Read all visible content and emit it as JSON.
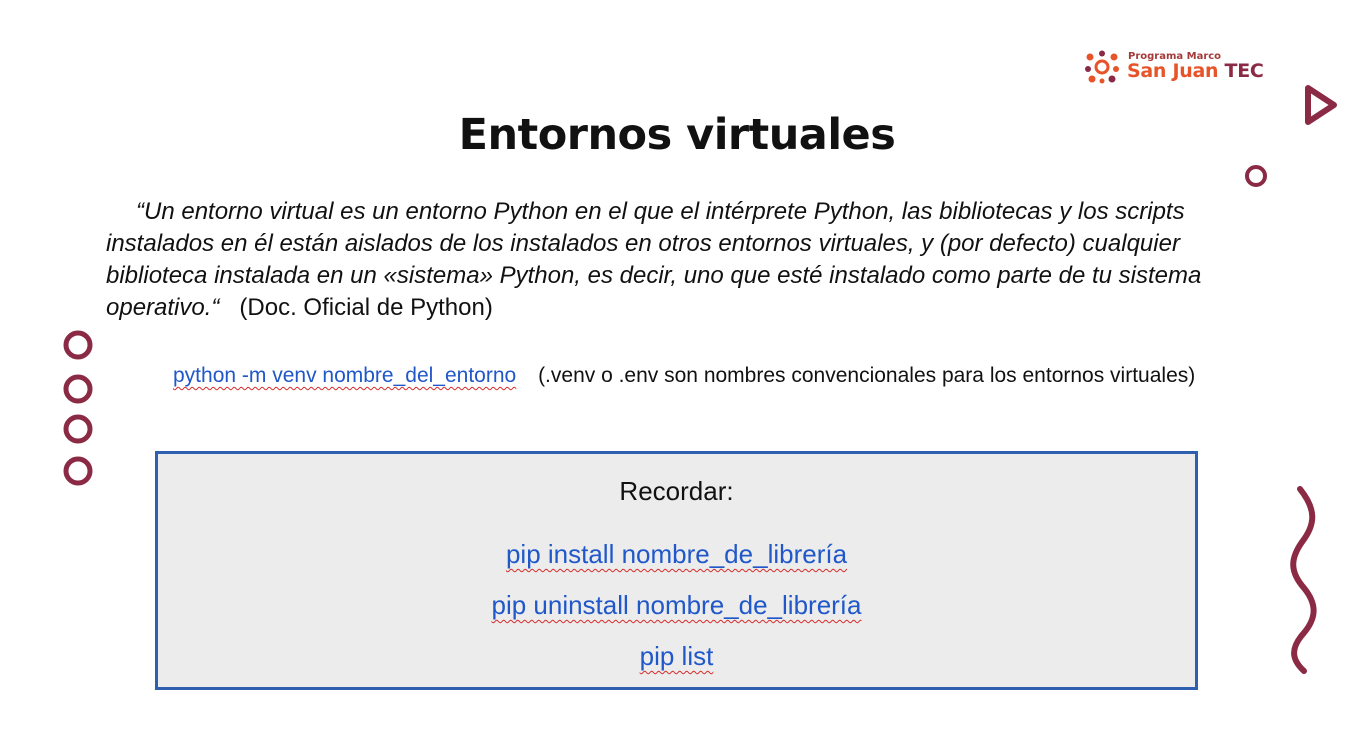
{
  "logo": {
    "small_text": "Programa Marco",
    "brand_main": "San Juan",
    "brand_suffix": "TEC"
  },
  "title": "Entornos virtuales",
  "quote": {
    "text": "“Un entorno virtual es un entorno Python en el que el intérprete Python, las bibliotecas y los scripts instalados en él están aislados de los instalados en otros entornos virtuales, y (por defecto) cualquier biblioteca instalada en un «sistema» Python, es decir, uno que esté instalado como parte de tu sistema operativo.“",
    "source": "(Doc. Oficial de Python)"
  },
  "command": {
    "code": "python -m venv nombre_del_entorno",
    "note": "(.venv o .env son nombres convencionales para los entornos virtuales)"
  },
  "reminder": {
    "title": "Recordar:",
    "commands": [
      "pip install nombre_de_librería",
      "pip uninstall nombre_de_librería",
      "pip list"
    ]
  },
  "colors": {
    "accent": "#8a2a45",
    "link": "#2057c9",
    "box_border": "#2f5fb0",
    "box_fill": "#ececec"
  }
}
